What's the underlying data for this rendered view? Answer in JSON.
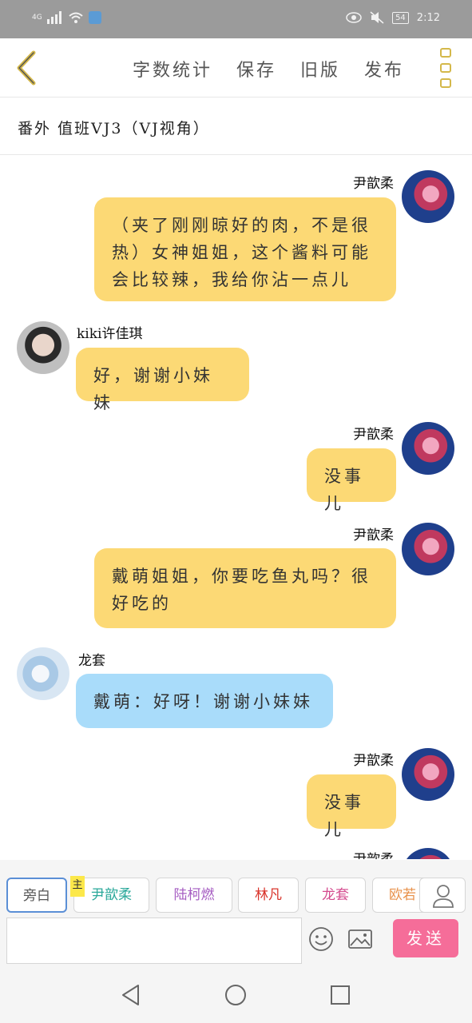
{
  "status_bar": {
    "network": "4G",
    "time": "2:12",
    "battery": "54"
  },
  "toolbar": {
    "word_count": "字数统计",
    "save": "保存",
    "old_version": "旧版",
    "publish": "发布"
  },
  "chapter_title": "番外 值班VJ3（VJ视角）",
  "messages": [
    {
      "sender": "尹歆柔",
      "side": "right",
      "color": "#fcd975",
      "text": "（夹了刚刚晾好的肉，不是很热）女神姐姐，这个酱料可能会比较辣，我给你沾一点儿"
    },
    {
      "sender": "kiki许佳琪",
      "side": "left",
      "color": "#fcd975",
      "text": "好，谢谢小妹妹"
    },
    {
      "sender": "尹歆柔",
      "side": "right",
      "color": "#fcd975",
      "text": "没事儿"
    },
    {
      "sender": "尹歆柔",
      "side": "right",
      "color": "#fcd975",
      "text": "戴萌姐姐，你要吃鱼丸吗？很好吃的"
    },
    {
      "sender": "龙套",
      "side": "left",
      "color": "#a9dcfa",
      "text": "戴萌：好呀！谢谢小妹妹"
    },
    {
      "sender": "尹歆柔",
      "side": "right",
      "color": "#fcd975",
      "text": "没事儿"
    },
    {
      "sender": "尹歆柔",
      "side": "right",
      "color": "#fcd975",
      "text": ""
    }
  ],
  "characters": [
    {
      "label": "旁白",
      "color": "#555555",
      "active": true
    },
    {
      "label": "尹歆柔",
      "color": "#2aa89a",
      "main_tag": "主"
    },
    {
      "label": "陆柯燃",
      "color": "#a65dc2"
    },
    {
      "label": "林凡",
      "color": "#d9342b"
    },
    {
      "label": "龙套",
      "color": "#d44a8e"
    },
    {
      "label": "欧若",
      "color": "#e8914a"
    }
  ],
  "input": {
    "value": "",
    "placeholder": ""
  },
  "send_label": "发送",
  "icons": [
    "back-arrow-icon",
    "more-menu-icon",
    "emoji-icon",
    "image-icon",
    "user-icon",
    "nav-back-icon",
    "nav-home-icon",
    "nav-recent-icon"
  ]
}
